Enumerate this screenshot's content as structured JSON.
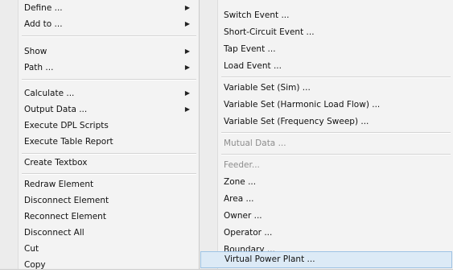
{
  "main_menu": {
    "items": [
      {
        "label": "Define ...",
        "has_submenu": true
      },
      {
        "label": "Add to ...",
        "has_submenu": true
      },
      {
        "label": "Show",
        "has_submenu": true
      },
      {
        "label": "Path ...",
        "has_submenu": true
      },
      {
        "label": "Calculate ...",
        "has_submenu": true
      },
      {
        "label": "Output Data ...",
        "has_submenu": true
      },
      {
        "label": "Execute DPL Scripts",
        "has_submenu": false
      },
      {
        "label": "Execute Table Report",
        "has_submenu": false
      },
      {
        "label": "Create Textbox",
        "has_submenu": false
      },
      {
        "label": "Redraw Element",
        "has_submenu": false
      },
      {
        "label": "Disconnect Element",
        "has_submenu": false
      },
      {
        "label": "Reconnect Element",
        "has_submenu": false
      },
      {
        "label": "Disconnect All",
        "has_submenu": false
      },
      {
        "label": "Cut",
        "has_submenu": false
      },
      {
        "label": "Copy",
        "has_submenu": false
      }
    ],
    "arrow_glyph": "▶"
  },
  "sub_menu": {
    "items": [
      {
        "label": "Switch Event ...",
        "disabled": false
      },
      {
        "label": "Short-Circuit Event ...",
        "disabled": false
      },
      {
        "label": "Tap Event ...",
        "disabled": false
      },
      {
        "label": "Load Event ...",
        "disabled": false
      },
      {
        "label": "Variable Set (Sim) ...",
        "disabled": false
      },
      {
        "label": "Variable Set (Harmonic Load Flow) ...",
        "disabled": false
      },
      {
        "label": "Variable Set (Frequency Sweep) ...",
        "disabled": false
      },
      {
        "label": "Mutual Data ...",
        "disabled": true
      },
      {
        "label": "Feeder...",
        "disabled": true
      },
      {
        "label": "Zone ...",
        "disabled": false
      },
      {
        "label": "Area ...",
        "disabled": false
      },
      {
        "label": "Owner ...",
        "disabled": false
      },
      {
        "label": "Operator ...",
        "disabled": false
      },
      {
        "label": "Boundary ...",
        "disabled": false
      },
      {
        "label": "Virtual Power Plant ...",
        "disabled": false
      }
    ],
    "highlighted_item": "Virtual Power Plant ..."
  },
  "colors": {
    "menu_background": "#f3f3f3",
    "highlight_background": "#dceaf6",
    "highlight_border": "#9ec3e4",
    "disabled_text": "#8d8d8d"
  }
}
